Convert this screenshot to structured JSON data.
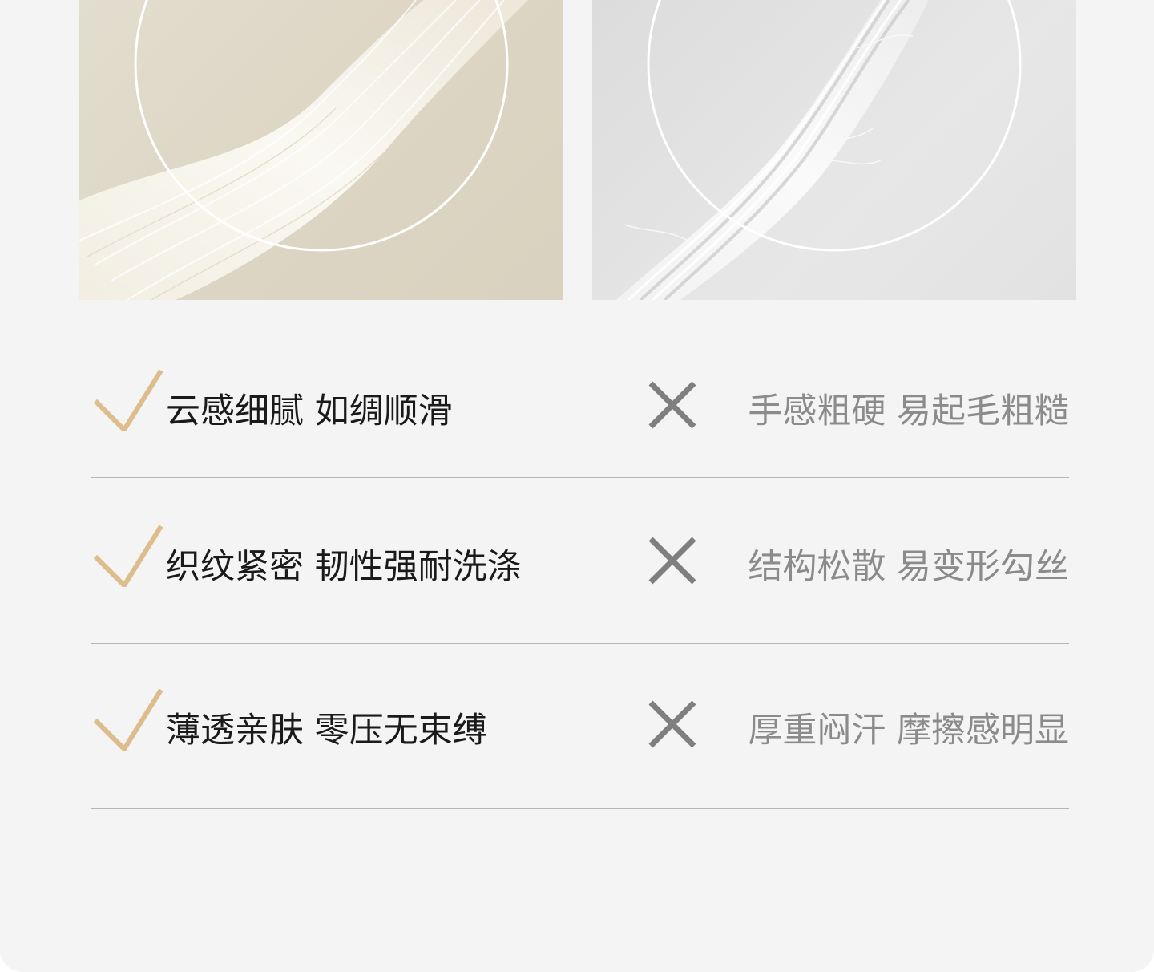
{
  "colors": {
    "background": "#f4f4f4",
    "check_gold": "#dcbd8b",
    "x_gray": "#7f7f7f",
    "good_text": "#1a1a1a",
    "bad_text": "#8b8b8b",
    "divider": "#b5b5b5"
  },
  "images": {
    "left": {
      "icon": "soft-smooth-fiber-strand-image"
    },
    "right": {
      "icon": "rough-twisted-fiber-strand-image"
    }
  },
  "comparison": {
    "rows": [
      {
        "good": "云感细腻 如绸顺滑",
        "bad": "手感粗硬 易起毛粗糙"
      },
      {
        "good": "织纹紧密 韧性强耐洗涤",
        "bad": "结构松散 易变形勾丝"
      },
      {
        "good": "薄透亲肤 零压无束缚",
        "bad": "厚重闷汗 摩擦感明显"
      }
    ]
  }
}
